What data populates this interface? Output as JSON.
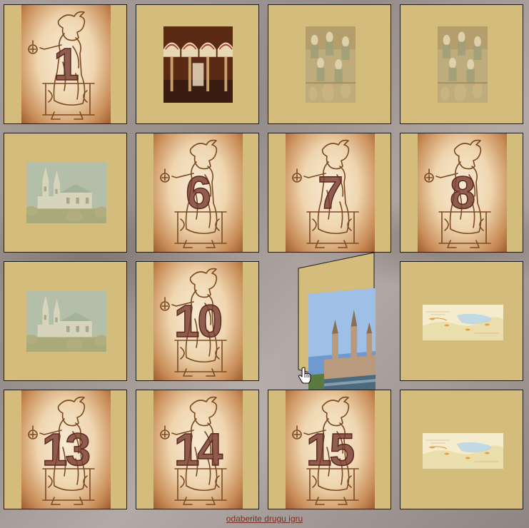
{
  "board": {
    "cards": [
      {
        "id": 1,
        "state": "hidden",
        "label": "1"
      },
      {
        "id": 2,
        "state": "revealed",
        "image": "mosque-arches-photo"
      },
      {
        "id": 3,
        "state": "revealed-faded",
        "image": "medieval-miniature-painting"
      },
      {
        "id": 4,
        "state": "revealed-faded",
        "image": "medieval-miniature-painting"
      },
      {
        "id": 5,
        "state": "revealed-faded",
        "image": "gothic-cathedral-photo"
      },
      {
        "id": 6,
        "state": "hidden",
        "label": "6"
      },
      {
        "id": 7,
        "state": "hidden",
        "label": "7"
      },
      {
        "id": 8,
        "state": "hidden",
        "label": "8"
      },
      {
        "id": 9,
        "state": "revealed-faded",
        "image": "gothic-cathedral-photo"
      },
      {
        "id": 10,
        "state": "hidden",
        "label": "10"
      },
      {
        "id": 11,
        "state": "flipping",
        "image": "river-basilica-photo"
      },
      {
        "id": 12,
        "state": "revealed",
        "image": "old-map-image"
      },
      {
        "id": 13,
        "state": "hidden",
        "label": "13"
      },
      {
        "id": 14,
        "state": "hidden",
        "label": "14"
      },
      {
        "id": 15,
        "state": "hidden",
        "label": "15"
      },
      {
        "id": 16,
        "state": "revealed",
        "image": "old-map-image"
      }
    ]
  },
  "footer": {
    "link_text": "odaberite drugu igru"
  },
  "colors": {
    "card_face": "#d4bc7c",
    "card_border": "#1c1c1c",
    "number": "#7a3e32",
    "link": "#7a2e22"
  }
}
